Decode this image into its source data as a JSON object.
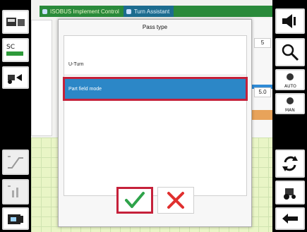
{
  "header": {
    "tab_implement": "ISOBUS Implement Control",
    "tab_assistant": "Turn Assistant"
  },
  "background": {
    "value_a": "5",
    "value_b": "5.0"
  },
  "dialog": {
    "title": "Pass type",
    "items": [
      {
        "label": "U-Turn",
        "selected": false
      },
      {
        "label": "Part field mode",
        "selected": true
      }
    ]
  },
  "colors": {
    "accent_blue": "#2c87c7",
    "highlight_red": "#c5213a",
    "confirm_green": "#2ea34a",
    "cancel_red": "#e0302f"
  },
  "icons": {
    "confirm": "checkmark-icon",
    "cancel": "x-icon",
    "speaker": "speaker-icon",
    "search": "magnifier-icon",
    "auto": "auto-mode-icon",
    "manual": "manual-mode-icon",
    "refresh": "refresh-icon",
    "tractor": "tractor-icon",
    "back": "back-arrow-icon"
  }
}
